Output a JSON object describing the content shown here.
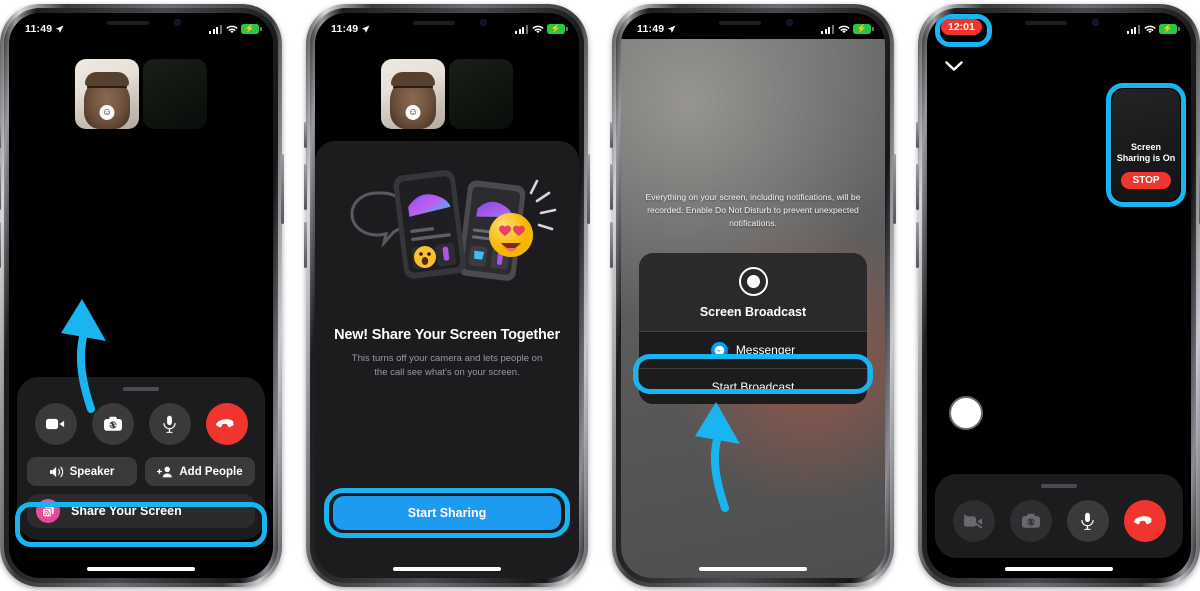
{
  "phones": [
    {
      "id": "phone-1-call-controls",
      "statusbar": {
        "time": "11:49",
        "location_icon": "location-arrow-icon",
        "signal_icon": "cellular-bars-icon",
        "wifi_icon": "wifi-icon",
        "battery_icon": "battery-charging-icon"
      },
      "controls": {
        "video_label": "video-camera-icon",
        "flip_label": "flip-camera-icon",
        "mic_label": "microphone-icon",
        "hangup_label": "end-call-icon",
        "speaker": "Speaker",
        "add_people": "Add People",
        "share_screen": "Share Your Screen"
      },
      "highlight": "share-your-screen-row",
      "arrow": "curved-arrow-pointing-up"
    },
    {
      "id": "phone-2-share-onboarding",
      "statusbar": {
        "time": "11:49"
      },
      "onboarding": {
        "title": "New! Share Your Screen Together",
        "subtitle": "This turns off your camera and lets people on the call see what's on your screen.",
        "button": "Start Sharing"
      },
      "highlight": "start-sharing-button"
    },
    {
      "id": "phone-3-screen-broadcast",
      "statusbar": {
        "time": "11:49"
      },
      "broadcast": {
        "note": "Everything on your screen, including notifications, will be recorded. Enable Do Not Disturb to prevent unexpected notifications.",
        "title": "Screen Broadcast",
        "app": "Messenger",
        "action": "Start Broadcast"
      },
      "highlight": "start-broadcast-button",
      "arrow": "curved-arrow-pointing-up"
    },
    {
      "id": "phone-4-sharing-active",
      "statusbar": {
        "time": "12:01"
      },
      "recording_time": "12:01",
      "panel": {
        "line1": "Screen",
        "line2": "Sharing is On",
        "stop": "STOP"
      },
      "controls": {
        "video_label": "video-camera-off-icon",
        "flip_label": "flip-camera-icon",
        "mic_label": "microphone-icon",
        "hangup_label": "end-call-icon"
      },
      "highlights": [
        "recording-time-pill",
        "screen-sharing-panel"
      ]
    }
  ],
  "colors": {
    "highlight": "#1ab4f0",
    "accent_blue": "#1d9bf0",
    "danger_red": "#f0352e",
    "share_pink": "#e8499b",
    "panel_dark": "#1c1c1e"
  }
}
